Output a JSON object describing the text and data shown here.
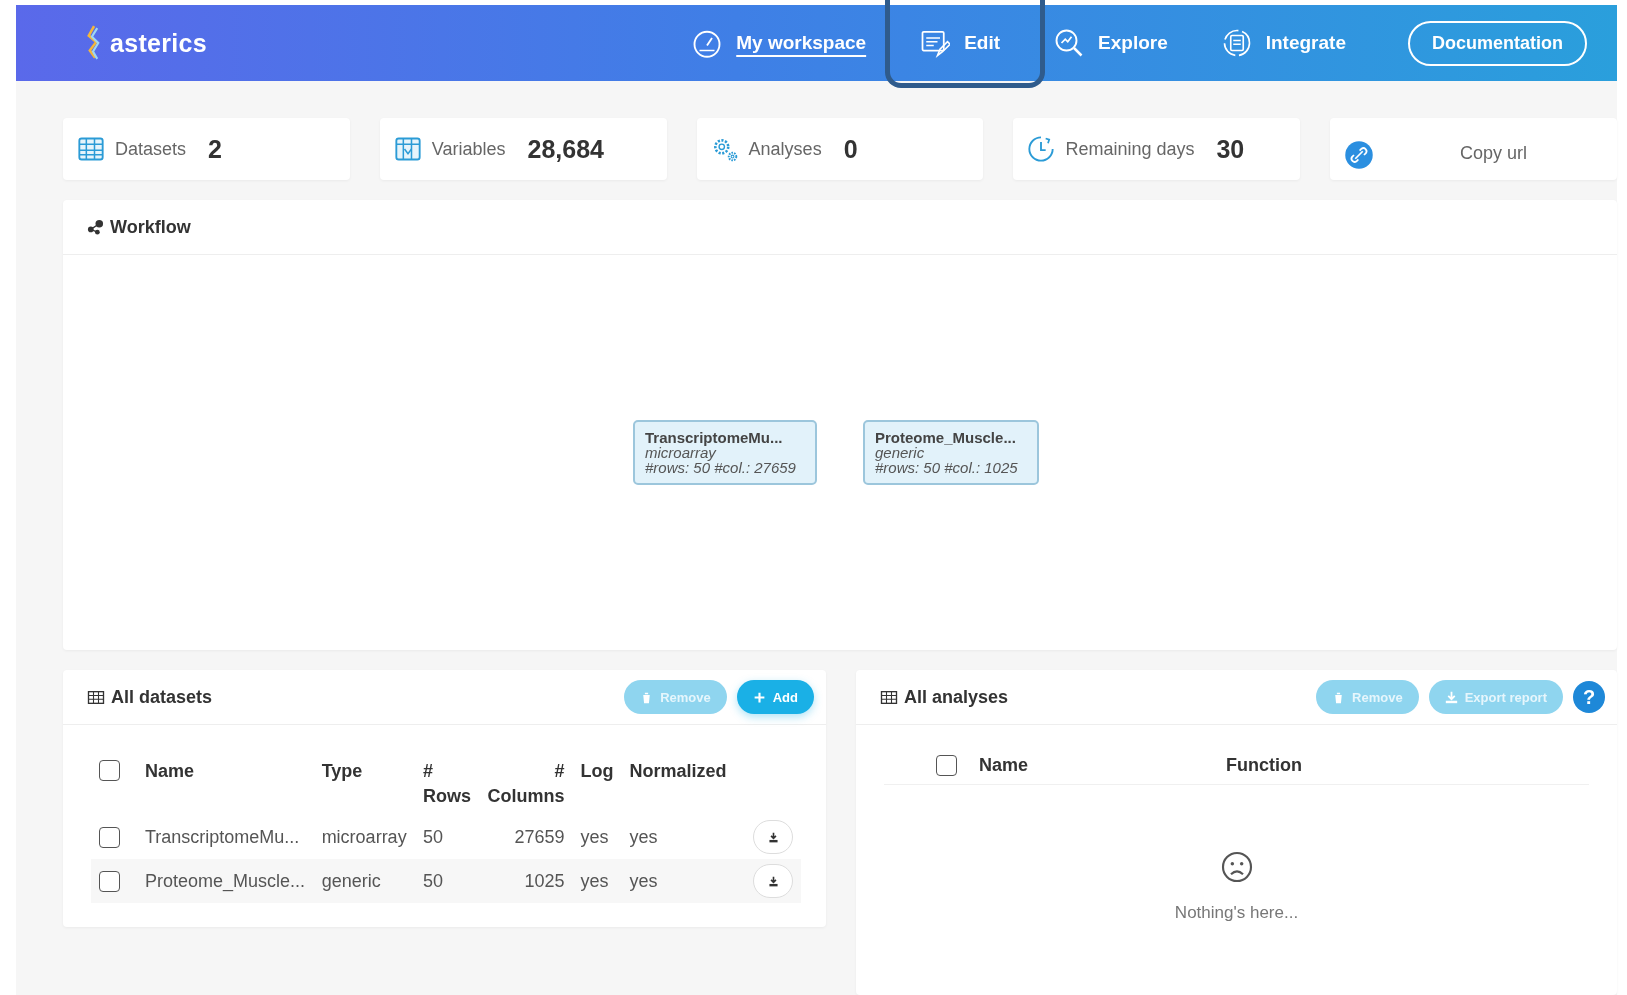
{
  "header": {
    "logo": "asterics",
    "nav": [
      {
        "label": "My workspace",
        "selected": true,
        "highlighted": false
      },
      {
        "label": "Edit",
        "selected": false,
        "highlighted": true
      },
      {
        "label": "Explore",
        "selected": false,
        "highlighted": false
      },
      {
        "label": "Integrate",
        "selected": false,
        "highlighted": false
      }
    ],
    "documentation": "Documentation"
  },
  "stats": [
    {
      "kind": "count",
      "label": "Datasets",
      "value": "2"
    },
    {
      "kind": "count",
      "label": "Variables",
      "value": "28,684"
    },
    {
      "kind": "count",
      "label": "Analyses",
      "value": "0"
    },
    {
      "kind": "count",
      "label": "Remaining days",
      "value": "30"
    },
    {
      "kind": "link",
      "label": "Copy url"
    }
  ],
  "workflow": {
    "title": "Workflow",
    "nodes": [
      {
        "name": "TranscriptomeMu...",
        "type": "microarray",
        "info": "#rows: 50 #col.: 27659"
      },
      {
        "name": "Proteome_Muscle...",
        "type": "generic",
        "info": "#rows: 50 #col.: 1025"
      }
    ]
  },
  "datasets": {
    "title": "All datasets",
    "buttons": [
      {
        "kind": "remove",
        "label": "Remove",
        "disabled": true
      },
      {
        "kind": "add",
        "label": "Add",
        "disabled": false
      }
    ],
    "select_all": {
      "checked": false
    },
    "columns": [
      "Name",
      "Type",
      "# Rows",
      "# Columns",
      "Log",
      "Normalized"
    ],
    "rows": [
      {
        "checked": false,
        "cells": [
          "TranscriptomeMu...",
          "microarray",
          "50",
          "27659",
          "yes",
          "yes"
        ]
      },
      {
        "checked": false,
        "cells": [
          "Proteome_Muscle...",
          "generic",
          "50",
          "1025",
          "yes",
          "yes"
        ]
      }
    ]
  },
  "analyses": {
    "title": "All analyses",
    "buttons": [
      {
        "kind": "remove",
        "label": "Remove",
        "disabled": true
      },
      {
        "kind": "export",
        "label": "Export report",
        "disabled": true
      },
      {
        "kind": "help",
        "label": "?",
        "disabled": false
      }
    ],
    "select_all": {
      "checked": false
    },
    "columns": [
      "Name",
      "Function"
    ],
    "empty": "Nothing's here..."
  }
}
